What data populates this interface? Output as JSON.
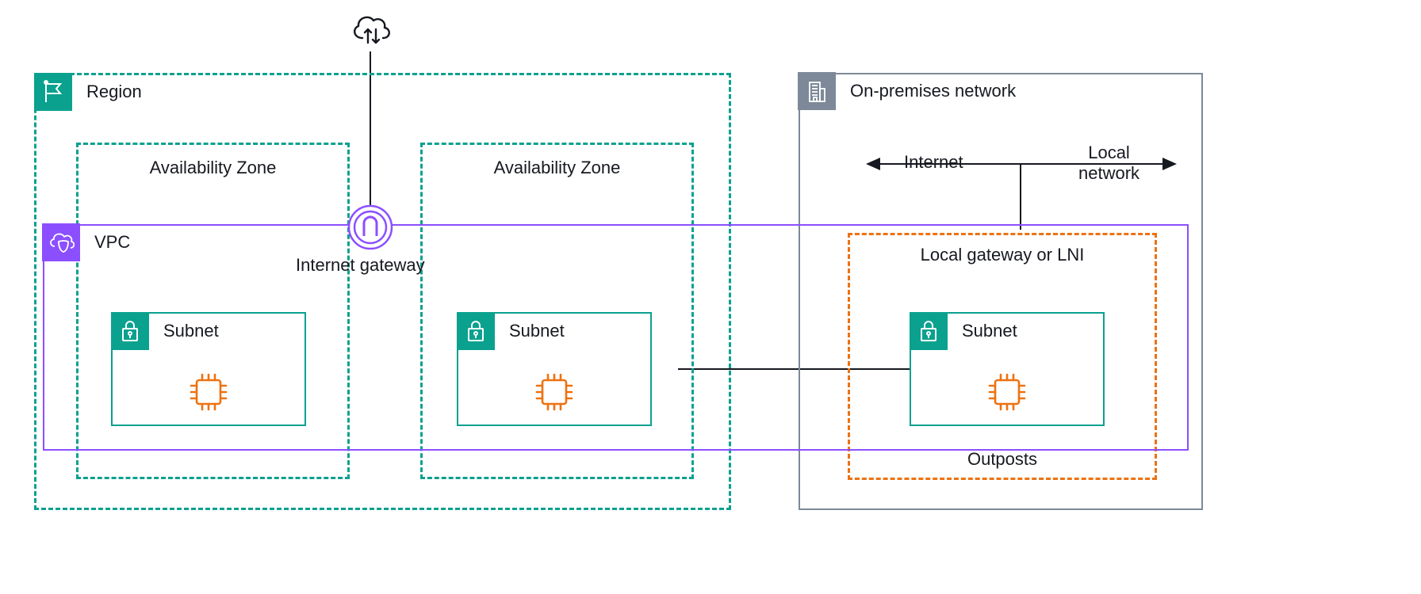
{
  "diagram": {
    "region_label": "Region",
    "vpc_label": "VPC",
    "az1_label": "Availability Zone",
    "az2_label": "Availability Zone",
    "igw_label": "Internet gateway",
    "onprem_label": "On-premises network",
    "internet_label": "Internet",
    "localnet_label_l1": "Local",
    "localnet_label_l2": "network",
    "lgw_label": "Local gateway or LNI",
    "outposts_label": "Outposts",
    "subnet_label": "Subnet"
  },
  "colors": {
    "teal": "#0aa18f",
    "purple": "#8c4fff",
    "orange": "#ed7211",
    "gray": "#7d8998",
    "black": "#16191f"
  },
  "icons": {
    "region": "flag-icon",
    "vpc": "cloud-shield-icon",
    "az": "dashed-box",
    "subnet": "lock-icon",
    "cpu": "chip-icon",
    "cloud": "cloud-arrows-icon",
    "igw": "gateway-icon",
    "building": "building-icon",
    "outposts": "dashed-box"
  }
}
